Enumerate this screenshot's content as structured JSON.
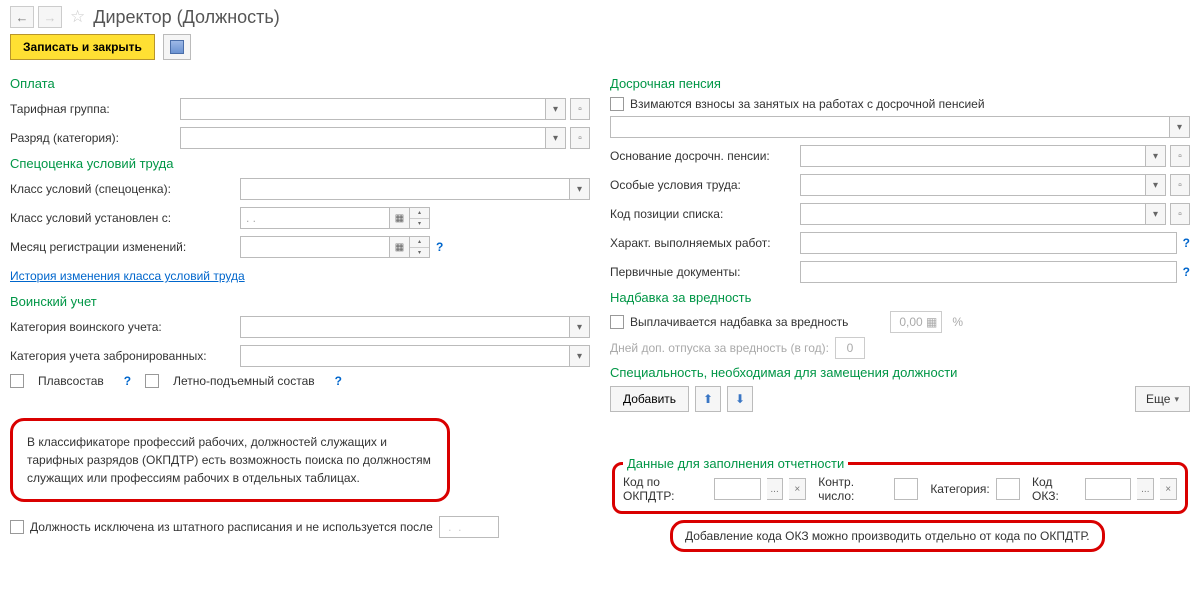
{
  "header": {
    "title": "Директор (Должность)"
  },
  "toolbar": {
    "save_close": "Записать и закрыть"
  },
  "left": {
    "payment": {
      "title": "Оплата",
      "tariff_group": "Тарифная группа:",
      "grade": "Разряд (категория):"
    },
    "spec": {
      "title": "Спецоценка условий труда",
      "class": "Класс условий (спецоценка):",
      "class_since": "Класс условий установлен с:",
      "reg_month": "Месяц регистрации изменений:",
      "history": "История изменения класса условий труда"
    },
    "military": {
      "title": "Воинский учет",
      "category": "Категория воинского учета:",
      "booked": "Категория учета забронированных:",
      "float": "Плавсостав",
      "flight": "Летно-подъемный состав"
    },
    "callout": "В классификаторе профессий рабочих, должностей служащих и тарифных разрядов (ОКПДТР) есть возможность поиска по должностям служащих или профессиям рабочих в отдельных таблицах.",
    "exclude": "Должность исключена из штатного расписания и не используется после"
  },
  "right": {
    "pension": {
      "title": "Досрочная пенсия",
      "chk": "Взимаются взносы за занятых на работах с досрочной пенсией",
      "basis": "Основание досрочн. пенсии:",
      "conditions": "Особые условия труда:",
      "code": "Код позиции списка:",
      "char": "Характ. выполняемых работ:",
      "docs": "Первичные документы:"
    },
    "bonus": {
      "title": "Надбавка за вредность",
      "chk": "Выплачивается надбавка за вредность",
      "value": "0,00",
      "pct": "%",
      "vacation": "Дней доп. отпуска за вредность (в год):",
      "vac_val": "0"
    },
    "speciality": {
      "title": "Специальность, необходимая для замещения должности",
      "add": "Добавить",
      "more": "Еще"
    },
    "report": {
      "title": "Данные для заполнения отчетности",
      "okpdtr": "Код по ОКПДТР:",
      "control": "Контр. число:",
      "category": "Категория:",
      "okz": "Код ОКЗ:"
    },
    "callout2": "Добавление кода ОКЗ можно производить отдельно от кода по ОКПДТР."
  },
  "placeholders": {
    "date": "  .  .    ",
    "dots": "..."
  }
}
